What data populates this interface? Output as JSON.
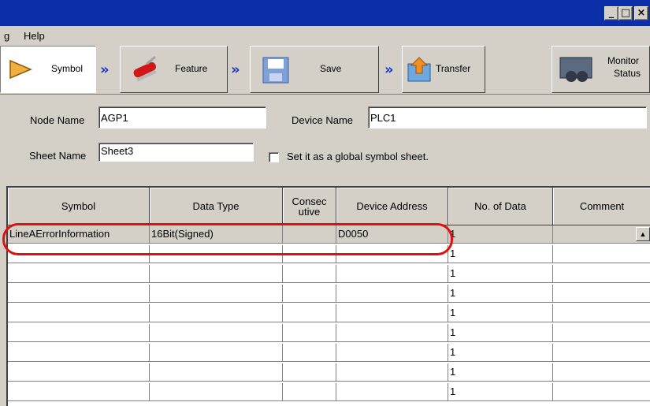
{
  "menu": {
    "partial": "g",
    "help": "Help"
  },
  "steps": {
    "symbol": "Symbol",
    "feature": "Feature",
    "save": "Save",
    "transfer": "Transfer",
    "monitor_line1": "Monitor",
    "monitor_line2": "Status"
  },
  "arrow_glyph": "»",
  "form": {
    "node_label": "Node Name",
    "node_value": "AGP1",
    "device_label": "Device Name",
    "device_value": "PLC1",
    "sheet_label": "Sheet Name",
    "sheet_value": "Sheet3",
    "global_label": "Set it as a global symbol sheet."
  },
  "table": {
    "headers": {
      "symbol": "Symbol",
      "data_type": "Data Type",
      "consecutive_1": "Consec",
      "consecutive_2": "utive",
      "device_address": "Device Address",
      "no_of_data": "No. of Data",
      "comment": "Comment"
    },
    "rows": [
      {
        "symbol": "LineAErrorInformation",
        "data_type": "16Bit(Signed)",
        "consecutive": "",
        "device_address": "D0050",
        "no_of_data": "1",
        "comment": ""
      },
      {
        "symbol": "",
        "data_type": "",
        "consecutive": "",
        "device_address": "",
        "no_of_data": "1",
        "comment": ""
      },
      {
        "symbol": "",
        "data_type": "",
        "consecutive": "",
        "device_address": "",
        "no_of_data": "1",
        "comment": ""
      },
      {
        "symbol": "",
        "data_type": "",
        "consecutive": "",
        "device_address": "",
        "no_of_data": "1",
        "comment": ""
      },
      {
        "symbol": "",
        "data_type": "",
        "consecutive": "",
        "device_address": "",
        "no_of_data": "1",
        "comment": ""
      },
      {
        "symbol": "",
        "data_type": "",
        "consecutive": "",
        "device_address": "",
        "no_of_data": "1",
        "comment": ""
      },
      {
        "symbol": "",
        "data_type": "",
        "consecutive": "",
        "device_address": "",
        "no_of_data": "1",
        "comment": ""
      },
      {
        "symbol": "",
        "data_type": "",
        "consecutive": "",
        "device_address": "",
        "no_of_data": "1",
        "comment": ""
      },
      {
        "symbol": "",
        "data_type": "",
        "consecutive": "",
        "device_address": "",
        "no_of_data": "1",
        "comment": ""
      }
    ]
  },
  "colors": {
    "titlebar": "#0a2fa8",
    "highlight": "#e01010",
    "arrow": "#1733d6"
  }
}
